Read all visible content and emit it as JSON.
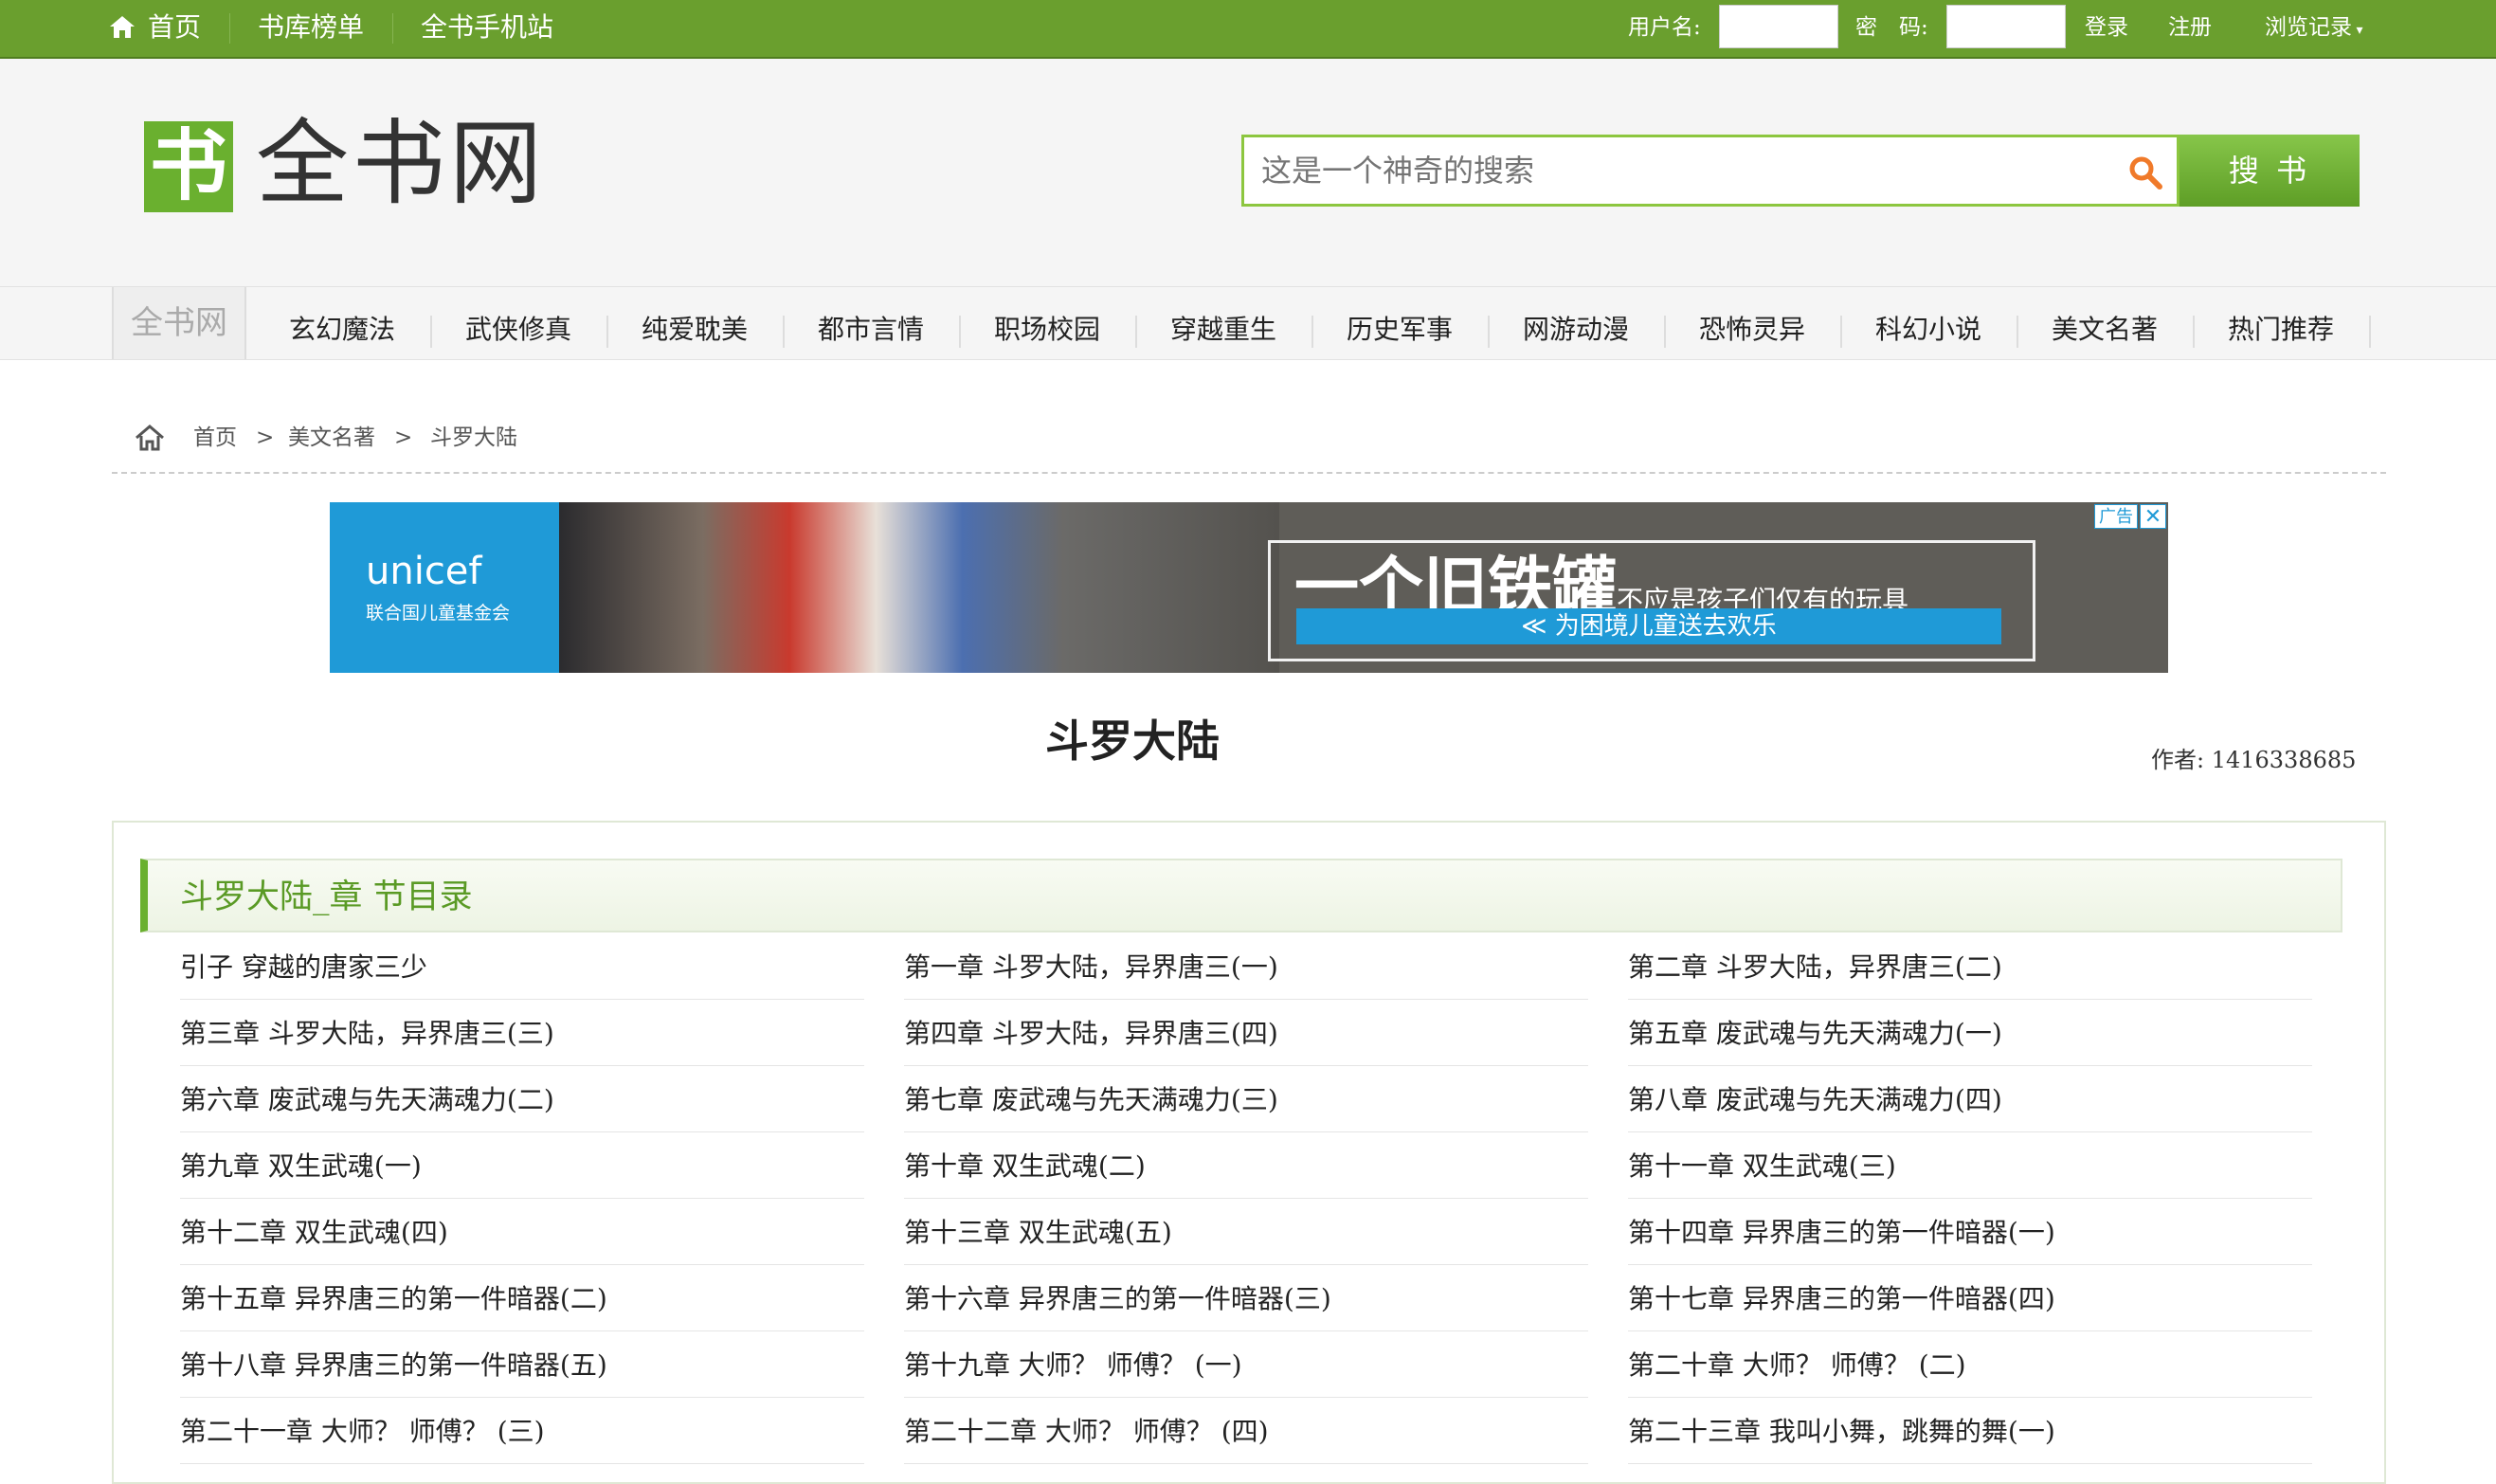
{
  "topbar": {
    "home_label": "首页",
    "nav_links": [
      "书库榜单",
      "全书手机站"
    ],
    "username_label": "用户名:",
    "password_label": "密　码:",
    "login_label": "登录",
    "register_label": "注册",
    "history_label": "浏览记录"
  },
  "header": {
    "logo_char": "书",
    "logo_text": "全书网",
    "search_placeholder": "这是一个神奇的搜索",
    "search_button": "搜 书"
  },
  "nav": {
    "home": "全书网",
    "items": [
      "玄幻魔法",
      "武侠修真",
      "纯爱耽美",
      "都市言情",
      "职场校园",
      "穿越重生",
      "历史军事",
      "网游动漫",
      "恐怖灵异",
      "科幻小说",
      "美文名著",
      "热门推荐"
    ]
  },
  "breadcrumb": {
    "items": [
      "首页",
      "美文名著",
      "斗罗大陆"
    ],
    "separator": ">"
  },
  "ad": {
    "brand": "unicef",
    "brand_sub": "联合国儿童基金会",
    "headline": "一个旧铁罐",
    "headline_small": "不应是孩子们仅有的玩具",
    "cta": "≪ 为困境儿童送去欢乐",
    "tag": "广告",
    "close": "✕"
  },
  "book": {
    "title": "斗罗大陆",
    "author": "作者: 1416338685"
  },
  "chapters_section": {
    "heading": "斗罗大陆_章 节目录",
    "chapters": [
      "引子 穿越的唐家三少",
      "第一章 斗罗大陆，异界唐三(一)",
      "第二章 斗罗大陆，异界唐三(二)",
      "第三章 斗罗大陆，异界唐三(三)",
      "第四章 斗罗大陆，异界唐三(四)",
      "第五章 废武魂与先天满魂力(一)",
      "第六章 废武魂与先天满魂力(二)",
      "第七章 废武魂与先天满魂力(三)",
      "第八章 废武魂与先天满魂力(四)",
      "第九章 双生武魂(一)",
      "第十章 双生武魂(二)",
      "第十一章 双生武魂(三)",
      "第十二章 双生武魂(四)",
      "第十三章 双生武魂(五)",
      "第十四章 异界唐三的第一件暗器(一)",
      "第十五章 异界唐三的第一件暗器(二)",
      "第十六章 异界唐三的第一件暗器(三)",
      "第十七章 异界唐三的第一件暗器(四)",
      "第十八章 异界唐三的第一件暗器(五)",
      "第十九章 大师？ 师傅？ (一)",
      "第二十章 大师？ 师傅？ (二)",
      "第二十一章 大师？ 师傅？ (三)",
      "第二十二章 大师？ 师傅？ (四)",
      "第二十三章 我叫小舞，跳舞的舞(一)"
    ]
  },
  "colors": {
    "brand_green": "#6a9f2e",
    "accent_green": "#6ab02f",
    "heading_green": "#5a9a25",
    "ad_blue": "#1f9ad7"
  }
}
